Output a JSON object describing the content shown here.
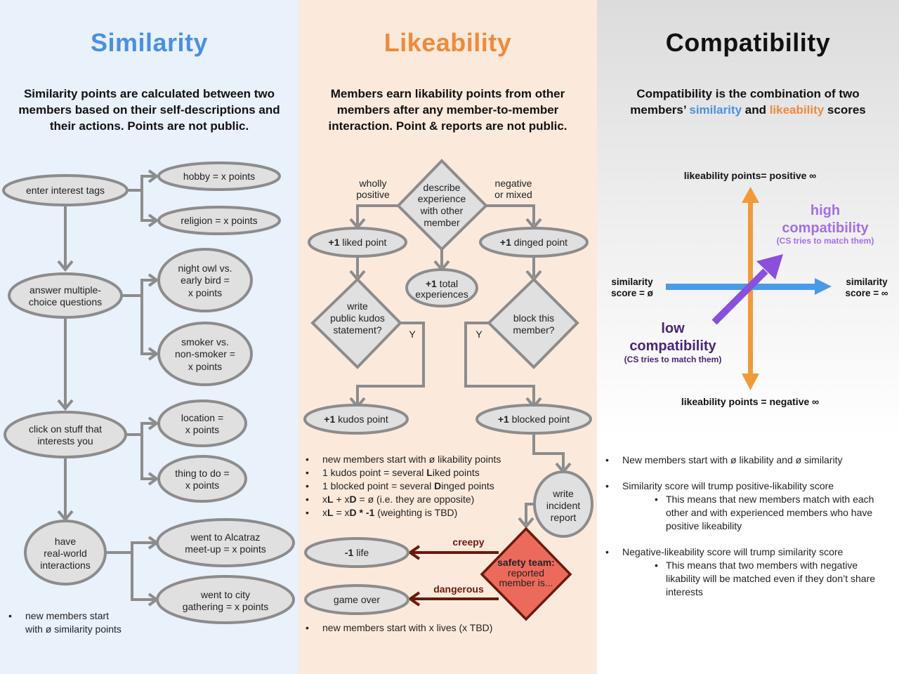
{
  "colors": {
    "similarity_blue": "#4a90e2",
    "likeability_orange": "#f08a3a",
    "compat_purple": "#8a4fdc",
    "low_compat_purple": "#4b2477",
    "high_compat_purple": "#a36ee6",
    "safety_red": "#ec6a5c",
    "safety_dark": "#6b1a0c"
  },
  "similarity": {
    "title": "Similarity",
    "subtitle_lines": [
      "Similarity points are calculated between two",
      "members based on their self-descriptions and",
      "their actions. Points are not public."
    ],
    "nodes": {
      "enter_tags": "enter interest tags",
      "hobby": "hobby = x points",
      "religion": "religion = x points",
      "answer_q": [
        "answer multiple-",
        "choice questions"
      ],
      "night_owl": [
        "night owl vs.",
        "early bird =",
        "x points"
      ],
      "smoker": [
        "smoker vs.",
        "non-smoker =",
        "x points"
      ],
      "click_stuff": [
        "click on stuff  that",
        "interests you"
      ],
      "location": [
        "location =",
        "x points"
      ],
      "thing_to_do": [
        "thing to do =",
        "x points"
      ],
      "real_world": [
        "have",
        "real-world",
        "interactions"
      ],
      "alcatraz": [
        "went to Alcatraz",
        "meet-up = x points"
      ],
      "city": [
        "went to city",
        "gathering = x points"
      ]
    },
    "bullets": [
      "new members start",
      "with ø similarity points"
    ]
  },
  "likeability": {
    "title": "Likeability",
    "subtitle_lines": [
      "Members earn likability points from other",
      "members after any member-to-member",
      "interaction.  Point & reports are not public."
    ],
    "nodes": {
      "describe": [
        "describe",
        "experience",
        "with other",
        "member"
      ],
      "wholly_positive": [
        "wholly",
        "positive"
      ],
      "negative_mixed": [
        "negative",
        "or mixed"
      ],
      "liked_bold": "+1",
      "liked": " liked point",
      "dinged_bold": "+1",
      "dinged": " dinged point",
      "total_bold": "+1",
      "total": [
        " total",
        "experiences"
      ],
      "kudos_q": [
        "write",
        "public kudos",
        "statement?"
      ],
      "block_q": [
        "block this",
        "member?"
      ],
      "yes_left": "Y",
      "yes_right": "Y",
      "kudos_bold": "+1",
      "kudos": " kudos point",
      "blocked_bold": "+1",
      "blocked": " blocked point",
      "incident": [
        "write",
        "incident",
        "report"
      ],
      "safety_bold": "safety team:",
      "safety": [
        "reported",
        "member is..."
      ],
      "creepy": "creepy",
      "dangerous": "dangerous",
      "life_bold": "-1",
      "life": " life",
      "game_over": "game over"
    },
    "bullets": [
      {
        "pre": "new members start with ø likability points"
      },
      {
        "pre": "1 kudos point = several ",
        "b": "L",
        "post": "iked points"
      },
      {
        "pre": "1 blocked point = several ",
        "b": "D",
        "post": "inged points"
      },
      {
        "pre": "x",
        "b": "L",
        "mid": " + x",
        "b2": "D",
        "post": " = ø (i.e. they are opposite)"
      },
      {
        "pre": "x",
        "b": "L",
        "mid": " = x",
        "b2": "D * -1",
        "post": " (weighting is TBD)"
      }
    ],
    "bottom_bullet": "new members start with x lives (x TBD)"
  },
  "compatibility": {
    "title": "Compatibility",
    "subtitle_line1": "Compatibility is the combination of two",
    "subtitle_pre": "members’ ",
    "subtitle_similarity": "similarity",
    "subtitle_and": " and ",
    "subtitle_likeability": "likeability",
    "subtitle_post": " scores",
    "axis_top": "likeability points= positive ∞",
    "axis_bottom": "likeability points = negative ∞",
    "axis_left": [
      "similarity",
      "score = ø"
    ],
    "axis_right": [
      "similarity",
      "score = ∞"
    ],
    "high": [
      "high",
      "compatibility",
      "(CS tries to match them)"
    ],
    "low": [
      "low",
      "compatibility",
      "(CS tries to match them)"
    ],
    "bullets": [
      {
        "text": "New members start with ø likability and ø similarity",
        "sub": false,
        "gap": false
      },
      {
        "text": "Similarity score will trump positive-likability score",
        "sub": false,
        "gap": true
      },
      {
        "text": "This means that new members match with each other and with experienced members who have positive likeability",
        "sub": true,
        "gap": false
      },
      {
        "text": "Negative-likeability score will trump similarity score",
        "sub": false,
        "gap": true
      },
      {
        "text": "This means that two members with negative likability will be matched even if they don’t share interests",
        "sub": true,
        "gap": false
      }
    ]
  }
}
